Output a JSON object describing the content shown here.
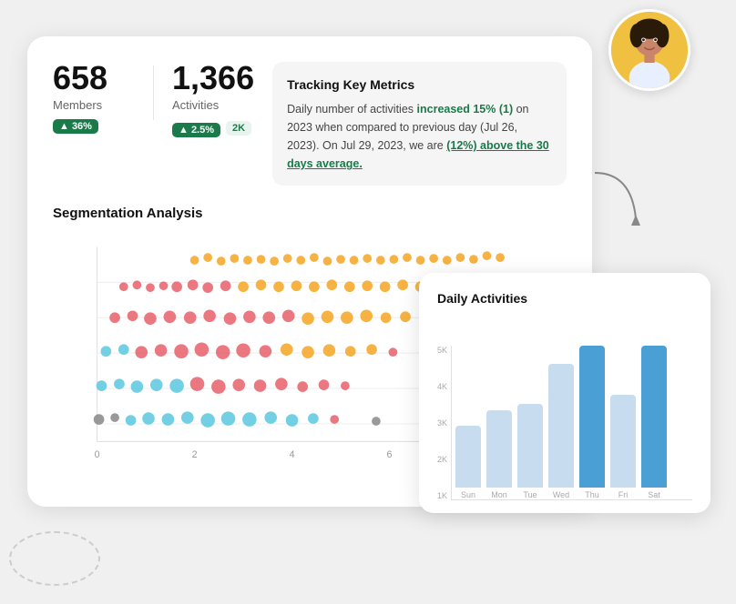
{
  "metrics": {
    "members": {
      "value": "658",
      "label": "Members",
      "badge": "▲ 36%"
    },
    "activities": {
      "value": "1,366",
      "label": "Activities",
      "badge": "▲ 2.5%",
      "badge2": "2K"
    }
  },
  "tracking": {
    "title": "Tracking Key Metrics",
    "text1": "Daily number of activities ",
    "highlight1": "increased 15% (1)",
    "text2": " on 2023 when compared to previous day (Jul 26, 2023). On Jul 29, 2023, we are ",
    "highlight2": "(12%) above the 30 days average.",
    "full": "Daily number of activities increased 15% (1) on 2023 when compared to previous day (Jul 26, 2023). On Jul 29, 2023, we are (12%) above the 30 days average."
  },
  "segmentation": {
    "title": "Segmentation Analysis"
  },
  "daily": {
    "title": "Daily Activities",
    "y_labels": [
      "5K",
      "4K",
      "3K",
      "2K",
      "1K"
    ],
    "bars": [
      {
        "label": "Sun",
        "value": 2000,
        "max": 5000,
        "highlighted": false
      },
      {
        "label": "Mon",
        "value": 2500,
        "max": 5000,
        "highlighted": false
      },
      {
        "label": "Tue",
        "value": 2700,
        "max": 5000,
        "highlighted": false
      },
      {
        "label": "Wed",
        "value": 4000,
        "max": 5000,
        "highlighted": false
      },
      {
        "label": "Thu",
        "value": 4800,
        "max": 5000,
        "highlighted": true
      },
      {
        "label": "Fri",
        "value": 3000,
        "max": 5000,
        "highlighted": false
      },
      {
        "label": "Sat",
        "value": 4700,
        "max": 5000,
        "highlighted": true
      }
    ]
  }
}
